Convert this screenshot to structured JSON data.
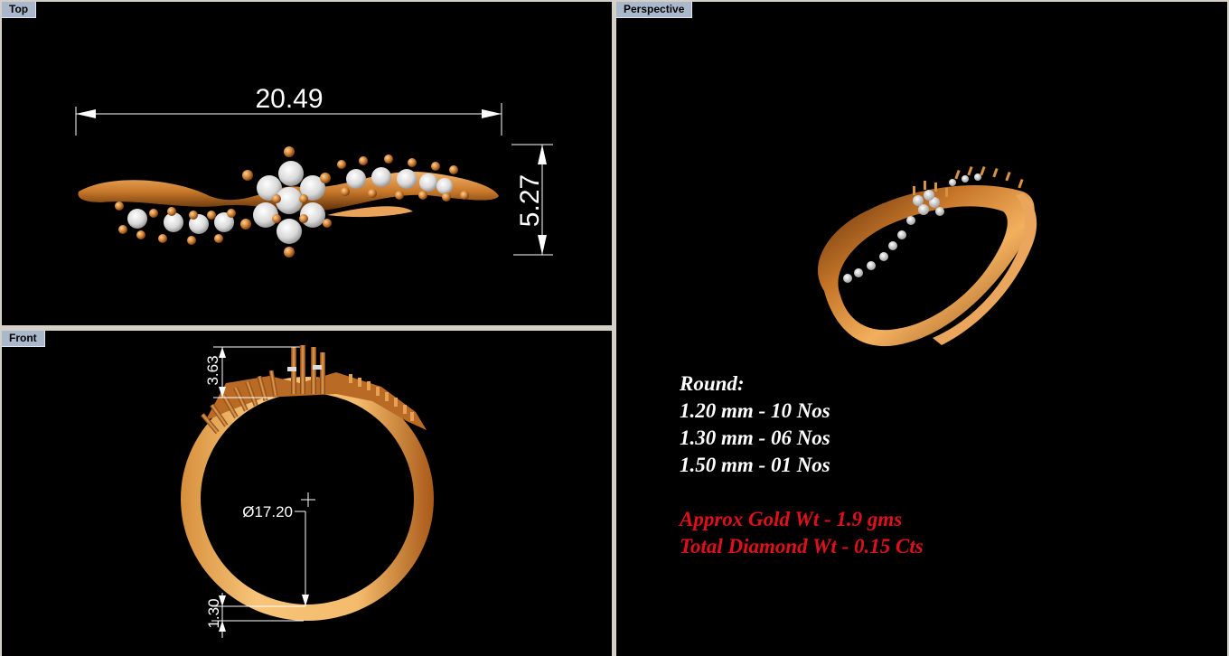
{
  "viewports": {
    "top": {
      "label": "Top"
    },
    "front": {
      "label": "Front"
    },
    "perspective": {
      "label": "Perspective"
    }
  },
  "dimensions": {
    "top_width": "20.49",
    "top_height": "5.27",
    "front_head": "3.63",
    "front_diameter": "Ø17.20",
    "front_shank": "1.30"
  },
  "stone_list": {
    "heading": "Round:",
    "rows": [
      "1.20 mm - 10 Nos",
      "1.30 mm - 06 Nos",
      "1.50 mm - 01 Nos"
    ]
  },
  "weights": {
    "gold": "Approx Gold Wt - 1.9 gms",
    "diamond": "Total Diamond Wt - 0.15 Cts"
  },
  "colors": {
    "background": "#000000",
    "gold": "#c8782a",
    "dimension_lines": "#ffffff",
    "weight_text": "#e0101a",
    "viewport_tab": "#aab8cc"
  }
}
